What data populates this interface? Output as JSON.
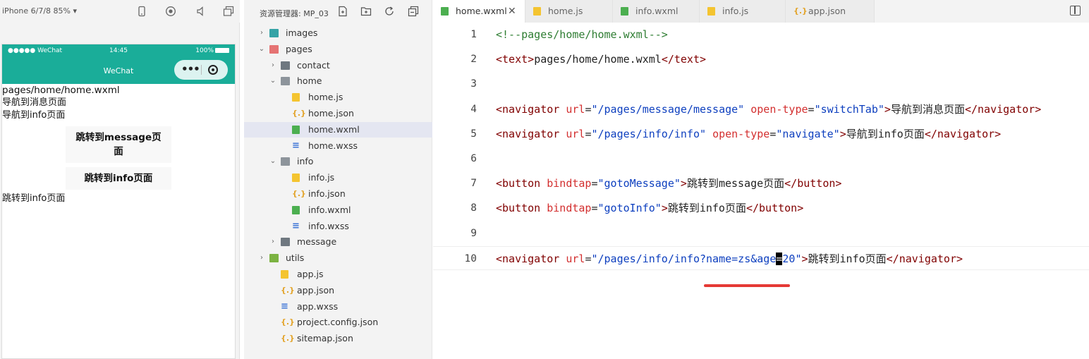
{
  "simulator": {
    "device_label": "iPhone 6/7/8 85% ▾",
    "toolbar_icons": [
      "phone-icon",
      "record-icon",
      "volume-icon",
      "window-icon"
    ],
    "status_bar": {
      "signal": "●●●●● WeChat",
      "time": "14:45",
      "battery": "100%"
    },
    "nav_title": "WeChat",
    "capsule_more": "•••",
    "page": {
      "lines_top": [
        "pages/home/home.wxml",
        "导航到消息页面",
        "导航到info页面"
      ],
      "buttons": [
        "跳转到message页面",
        "跳转到info页面"
      ],
      "line_bottom": "跳转到info页面"
    }
  },
  "explorer": {
    "title": "资源管理器: MP_03",
    "toolbar_icons": [
      "new-file-icon",
      "new-folder-icon",
      "refresh-icon",
      "collapse-icon"
    ],
    "tree": [
      {
        "label": "images",
        "kind": "images",
        "depth": 0,
        "arrow": "›",
        "selected": false
      },
      {
        "label": "pages",
        "kind": "pages",
        "depth": 0,
        "arrow": "⌄",
        "selected": false
      },
      {
        "label": "contact",
        "kind": "folder",
        "depth": 1,
        "arrow": "›",
        "selected": false
      },
      {
        "label": "home",
        "kind": "folder-open",
        "depth": 1,
        "arrow": "⌄",
        "selected": false
      },
      {
        "label": "home.js",
        "kind": "js",
        "depth": 2,
        "arrow": "",
        "selected": false
      },
      {
        "label": "home.json",
        "kind": "json",
        "depth": 2,
        "arrow": "",
        "selected": false
      },
      {
        "label": "home.wxml",
        "kind": "wxml",
        "depth": 2,
        "arrow": "",
        "selected": true
      },
      {
        "label": "home.wxss",
        "kind": "wxss",
        "depth": 2,
        "arrow": "",
        "selected": false
      },
      {
        "label": "info",
        "kind": "folder-open",
        "depth": 1,
        "arrow": "⌄",
        "selected": false
      },
      {
        "label": "info.js",
        "kind": "js",
        "depth": 2,
        "arrow": "",
        "selected": false
      },
      {
        "label": "info.json",
        "kind": "json",
        "depth": 2,
        "arrow": "",
        "selected": false
      },
      {
        "label": "info.wxml",
        "kind": "wxml",
        "depth": 2,
        "arrow": "",
        "selected": false
      },
      {
        "label": "info.wxss",
        "kind": "wxss",
        "depth": 2,
        "arrow": "",
        "selected": false
      },
      {
        "label": "message",
        "kind": "folder",
        "depth": 1,
        "arrow": "›",
        "selected": false
      },
      {
        "label": "utils",
        "kind": "utils",
        "depth": 0,
        "arrow": "›",
        "selected": false
      },
      {
        "label": "app.js",
        "kind": "js",
        "depth": 1,
        "arrow": "",
        "selected": false
      },
      {
        "label": "app.json",
        "kind": "json",
        "depth": 1,
        "arrow": "",
        "selected": false
      },
      {
        "label": "app.wxss",
        "kind": "wxss",
        "depth": 1,
        "arrow": "",
        "selected": false
      },
      {
        "label": "project.config.json",
        "kind": "json",
        "depth": 1,
        "arrow": "",
        "selected": false
      },
      {
        "label": "sitemap.json",
        "kind": "json",
        "depth": 1,
        "arrow": "",
        "selected": false
      }
    ]
  },
  "editor": {
    "tabs": [
      {
        "label": "home.wxml",
        "kind": "wxml",
        "active": true,
        "close": "✕"
      },
      {
        "label": "home.js",
        "kind": "js",
        "active": false,
        "close": ""
      },
      {
        "label": "info.wxml",
        "kind": "wxml",
        "active": false,
        "close": ""
      },
      {
        "label": "info.js",
        "kind": "js",
        "active": false,
        "close": ""
      },
      {
        "label": "app.json",
        "kind": "json",
        "active": false,
        "close": ""
      }
    ],
    "current_line": 10,
    "lines": [
      {
        "n": "1",
        "tokens": [
          {
            "t": "com",
            "s": "<!--pages/home/home.wxml-->"
          }
        ]
      },
      {
        "n": "2",
        "tokens": [
          {
            "t": "tag",
            "s": "<text>"
          },
          {
            "t": "txt",
            "s": "pages/home/home.wxml"
          },
          {
            "t": "tag",
            "s": "</text>"
          }
        ]
      },
      {
        "n": "3",
        "tokens": []
      },
      {
        "n": "4",
        "tokens": [
          {
            "t": "tag",
            "s": "<navigator "
          },
          {
            "t": "attr",
            "s": "url"
          },
          {
            "t": "txt",
            "s": "="
          },
          {
            "t": "str",
            "s": "\"/pages/message/message\""
          },
          {
            "t": "txt",
            "s": " "
          },
          {
            "t": "attr",
            "s": "open-type"
          },
          {
            "t": "txt",
            "s": "="
          },
          {
            "t": "str",
            "s": "\"switchTab\""
          },
          {
            "t": "tag",
            "s": ">"
          },
          {
            "t": "txt",
            "s": "导航到消息页面"
          },
          {
            "t": "tag",
            "s": "</navigator>"
          }
        ]
      },
      {
        "n": "5",
        "tokens": [
          {
            "t": "tag",
            "s": "<navigator "
          },
          {
            "t": "attr",
            "s": "url"
          },
          {
            "t": "txt",
            "s": "="
          },
          {
            "t": "str",
            "s": "\"/pages/info/info\""
          },
          {
            "t": "txt",
            "s": " "
          },
          {
            "t": "attr",
            "s": "open-type"
          },
          {
            "t": "txt",
            "s": "="
          },
          {
            "t": "str",
            "s": "\"navigate\""
          },
          {
            "t": "tag",
            "s": ">"
          },
          {
            "t": "txt",
            "s": "导航到info页面"
          },
          {
            "t": "tag",
            "s": "</navigator>"
          }
        ]
      },
      {
        "n": "6",
        "tokens": []
      },
      {
        "n": "7",
        "tokens": [
          {
            "t": "tag",
            "s": "<button "
          },
          {
            "t": "attr",
            "s": "bindtap"
          },
          {
            "t": "txt",
            "s": "="
          },
          {
            "t": "str",
            "s": "\"gotoMessage\""
          },
          {
            "t": "tag",
            "s": ">"
          },
          {
            "t": "txt",
            "s": "跳转到message页面"
          },
          {
            "t": "tag",
            "s": "</button>"
          }
        ]
      },
      {
        "n": "8",
        "tokens": [
          {
            "t": "tag",
            "s": "<button "
          },
          {
            "t": "attr",
            "s": "bindtap"
          },
          {
            "t": "txt",
            "s": "="
          },
          {
            "t": "str",
            "s": "\"gotoInfo\""
          },
          {
            "t": "tag",
            "s": ">"
          },
          {
            "t": "txt",
            "s": "跳转到info页面"
          },
          {
            "t": "tag",
            "s": "</button>"
          }
        ]
      },
      {
        "n": "9",
        "tokens": []
      },
      {
        "n": "10",
        "tokens": [
          {
            "t": "tag",
            "s": "<navigator "
          },
          {
            "t": "attr",
            "s": "url"
          },
          {
            "t": "txt",
            "s": "="
          },
          {
            "t": "str",
            "s": "\"/pages/info/info?name=zs&age"
          },
          {
            "t": "cursor",
            "s": "="
          },
          {
            "t": "str",
            "s": "20\""
          },
          {
            "t": "tag",
            "s": ">"
          },
          {
            "t": "txt",
            "s": "跳转到info页面"
          },
          {
            "t": "tag",
            "s": "</navigator>"
          }
        ]
      }
    ]
  },
  "colors": {
    "wechat_header": "#1aad99",
    "annotation_underline": "#e53935",
    "selected_row": "#e4e6f1"
  }
}
